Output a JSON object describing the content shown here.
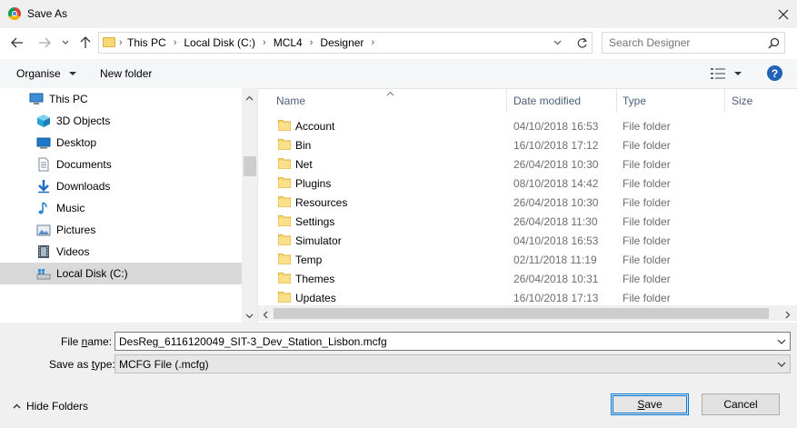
{
  "window": {
    "title": "Save As"
  },
  "address": {
    "breadcrumbs": [
      "This PC",
      "Local Disk (C:)",
      "MCL4",
      "Designer"
    ]
  },
  "search": {
    "placeholder": "Search Designer"
  },
  "toolbar": {
    "organise_label": "Organise",
    "new_folder_label": "New folder",
    "help_label": "?"
  },
  "sidebar": {
    "items": [
      {
        "label": "This PC",
        "icon": "computer-icon"
      },
      {
        "label": "3D Objects",
        "icon": "cube-icon"
      },
      {
        "label": "Desktop",
        "icon": "desktop-icon"
      },
      {
        "label": "Documents",
        "icon": "document-icon"
      },
      {
        "label": "Downloads",
        "icon": "download-icon"
      },
      {
        "label": "Music",
        "icon": "music-icon"
      },
      {
        "label": "Pictures",
        "icon": "pictures-icon"
      },
      {
        "label": "Videos",
        "icon": "video-icon"
      },
      {
        "label": "Local Disk (C:)",
        "icon": "drive-icon",
        "selected": true
      }
    ]
  },
  "columns": {
    "name": "Name",
    "date": "Date modified",
    "type": "Type",
    "size": "Size"
  },
  "files": [
    {
      "name": "Account",
      "date": "04/10/2018 16:53",
      "type": "File folder"
    },
    {
      "name": "Bin",
      "date": "16/10/2018 17:12",
      "type": "File folder"
    },
    {
      "name": "Net",
      "date": "26/04/2018 10:30",
      "type": "File folder"
    },
    {
      "name": "Plugins",
      "date": "08/10/2018 14:42",
      "type": "File folder"
    },
    {
      "name": "Resources",
      "date": "26/04/2018 10:30",
      "type": "File folder"
    },
    {
      "name": "Settings",
      "date": "26/04/2018 11:30",
      "type": "File folder"
    },
    {
      "name": "Simulator",
      "date": "04/10/2018 16:53",
      "type": "File folder"
    },
    {
      "name": "Temp",
      "date": "02/11/2018 11:19",
      "type": "File folder"
    },
    {
      "name": "Themes",
      "date": "26/04/2018 10:31",
      "type": "File folder"
    },
    {
      "name": "Updates",
      "date": "16/10/2018 17:13",
      "type": "File folder"
    }
  ],
  "form": {
    "filename_label_pre": "File ",
    "filename_label_u": "n",
    "filename_label_post": "ame:",
    "filename_value": "DesReg_6116120049_SIT-3_Dev_Station_Lisbon.mcfg",
    "type_label_pre": "Save as ",
    "type_label_u": "t",
    "type_label_post": "ype:",
    "type_value": "MCFG File (.mcfg)"
  },
  "footer": {
    "hide_folders_label": "Hide Folders",
    "save_label_u": "S",
    "save_label_post": "ave",
    "cancel_label": "Cancel"
  },
  "colors": {
    "accent": "#0078d7",
    "folder": "#f8d775",
    "help": "#1f62b6"
  }
}
